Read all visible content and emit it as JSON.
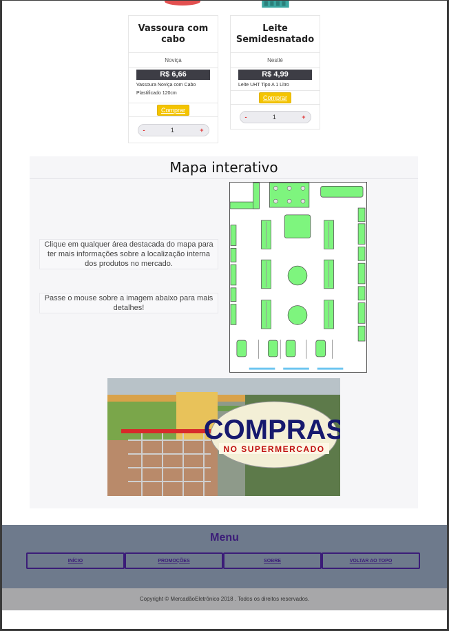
{
  "products": [
    {
      "name": "Vassoura com cabo",
      "brand": "Noviça",
      "price": "R$ 6,66",
      "description": "Vassoura Noviça com Cabo Plastificado 120cm",
      "buy_label": "Comprar",
      "quantity": "1",
      "minus": "-",
      "plus": "+"
    },
    {
      "name": "Leite Semidesnatado",
      "brand": "Nestlé",
      "price": "R$ 4,99",
      "description": "Leite UHT Tipo A 1 Litro",
      "buy_label": "Comprar",
      "quantity": "1",
      "minus": "-",
      "plus": "+"
    }
  ],
  "map_section": {
    "title": "Mapa interativo",
    "info_click": "Clique em qualquer área destacada do mapa para ter mais informações sobre a localização interna dos produtos no mercado.",
    "info_hover": "Passe o mouse sobre a imagem abaixo para mais detalhes!"
  },
  "banner": {
    "title": "COMPRAS",
    "subtitle": "NO SUPERMERCADO"
  },
  "menu": {
    "title": "Menu",
    "items": [
      "INÍCIO",
      "PROMOÇÕES",
      "SOBRE",
      "VOLTAR AO TOPO"
    ]
  },
  "footer": {
    "copyright": "Copyright © MercadãoEletrônico 2018 . Todos os direitos reservados."
  },
  "colors": {
    "area_green": "#7ef57e",
    "menu_band": "#6e7a8c",
    "menu_accent": "#3b1c78",
    "buy_button": "#f4c400"
  }
}
